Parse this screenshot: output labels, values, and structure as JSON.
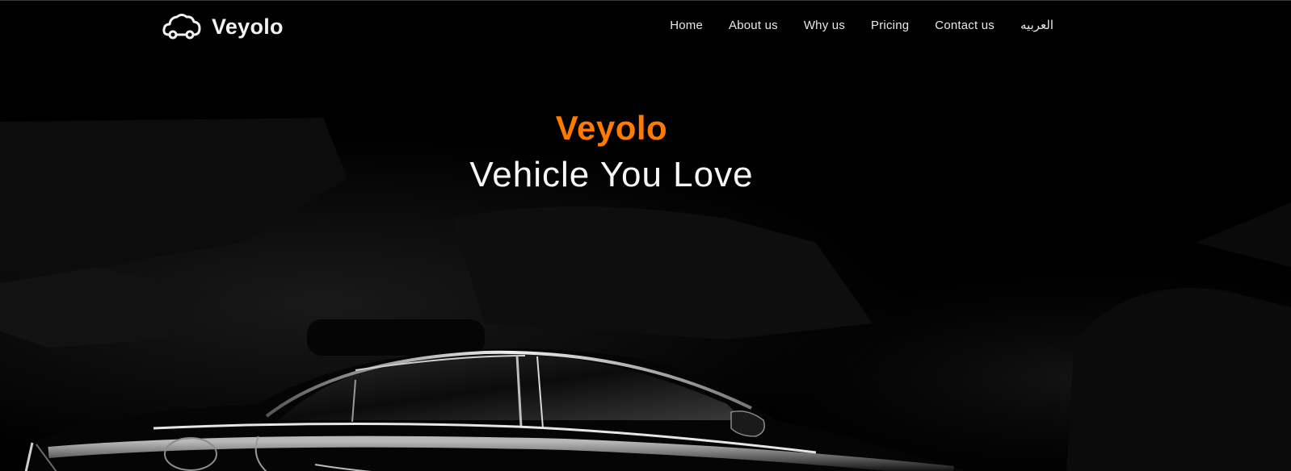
{
  "navbar": {
    "brand_name": "Veyolo",
    "brand_icon": "cloud-car-icon",
    "links": [
      {
        "label": "Home"
      },
      {
        "label": "About us"
      },
      {
        "label": "Why us"
      },
      {
        "label": "Pricing"
      },
      {
        "label": "Contact us"
      },
      {
        "label": "العربيه"
      }
    ]
  },
  "hero": {
    "title": "Veyolo",
    "subtitle": "Vehicle You Love",
    "background": "car-silhouette-image"
  },
  "colors": {
    "accent": "#ff7a00",
    "background": "#000000",
    "text": "#ffffff"
  }
}
